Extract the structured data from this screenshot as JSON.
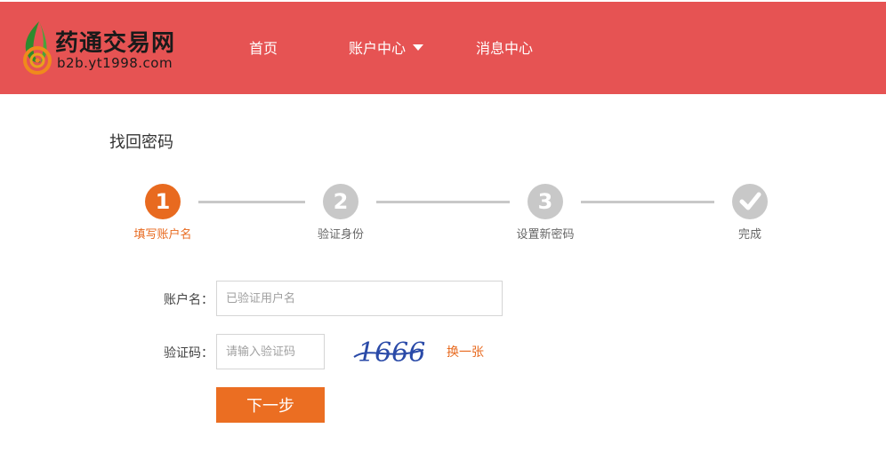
{
  "header": {
    "logo_title": "药通交易网",
    "logo_domain": "b2b.yt1998.com",
    "nav": {
      "home": "首页",
      "account": "账户中心",
      "messages": "消息中心"
    }
  },
  "page": {
    "title": "找回密码"
  },
  "steps": [
    {
      "number": "1",
      "label": "填写账户名",
      "state": "active"
    },
    {
      "number": "2",
      "label": "验证身份",
      "state": "pending"
    },
    {
      "number": "3",
      "label": "设置新密码",
      "state": "pending"
    },
    {
      "number": "",
      "label": "完成",
      "state": "pending",
      "icon": "check-icon"
    }
  ],
  "form": {
    "account_label": "账户名：",
    "account_placeholder": "已验证用户名",
    "captcha_label": "验证码：",
    "captcha_placeholder": "请输入验证码",
    "captcha_text": "1666",
    "refresh_label": "换一张",
    "next_label": "下一步"
  },
  "colors": {
    "header_bg": "#e65353",
    "accent": "#e86a1f",
    "inactive": "#c8c8c8",
    "captcha": "#2a4aa8"
  }
}
